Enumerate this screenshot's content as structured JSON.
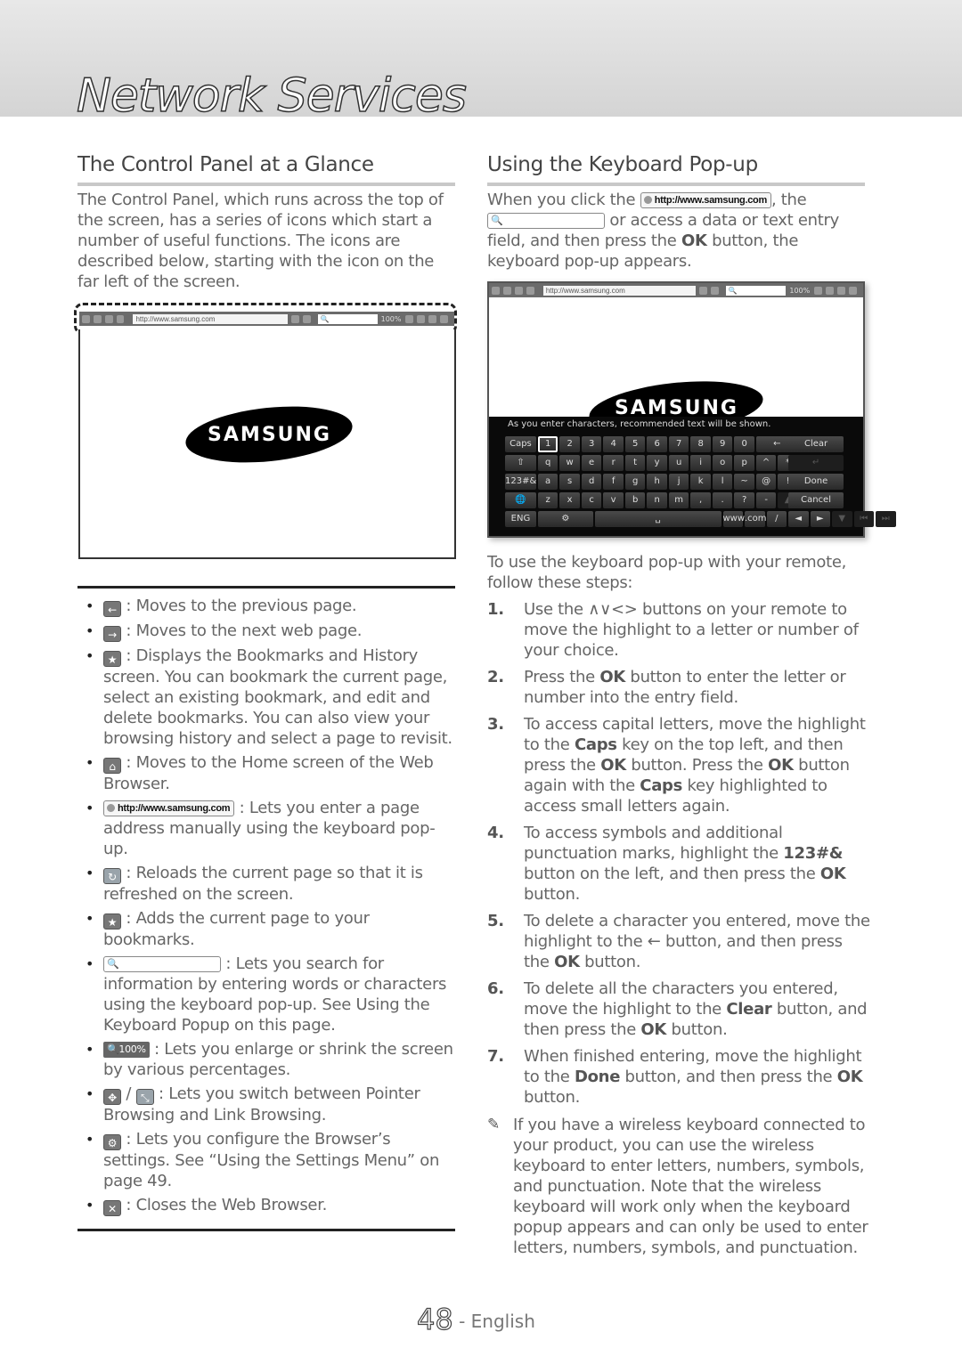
{
  "page": {
    "chapter_title": "Network Services",
    "page_number": "48",
    "language": "- English"
  },
  "left": {
    "title": "The Control Panel at a Glance",
    "intro": "The Control Panel, which runs across the top of the screen, has a series of icons which start a number of useful functions. The icons are described below, starting with the icon on the far left of the screen.",
    "toolbar": {
      "url": "http://www.samsung.com",
      "zoom": "100%",
      "search_icon": "🔍"
    },
    "logo": "SAMSUNG",
    "bullets": [
      {
        "icon": "back-arrow-icon",
        "glyph": "←",
        "text": ": Moves to the previous page."
      },
      {
        "icon": "forward-arrow-icon",
        "glyph": "→",
        "text": ": Moves to the next web page."
      },
      {
        "icon": "bookmarks-icon",
        "glyph": "★",
        "text": ": Displays the Bookmarks and History screen. You can bookmark the current page, select an existing bookmark, and edit and delete bookmarks. You can also view your browsing history and select a page to revisit."
      },
      {
        "icon": "home-icon",
        "glyph": "⌂",
        "text": ": Moves to the Home screen of the Web Browser."
      },
      {
        "icon": "url-field-icon",
        "glyph": "http://www.samsung.com",
        "text": ": Lets you enter a page address manually using the keyboard pop-up."
      },
      {
        "icon": "reload-icon",
        "glyph": "↻",
        "text": ": Reloads the current page so that it is refreshed on the screen."
      },
      {
        "icon": "add-bookmark-icon",
        "glyph": "★",
        "text": ": Adds the current page to your bookmarks."
      },
      {
        "icon": "search-field-icon",
        "glyph": "🔍",
        "text": ": Lets you search for information by entering words or characters using the keyboard pop-up. See Using the Keyboard Popup on this page."
      },
      {
        "icon": "zoom-icon",
        "glyph": "🔍100%",
        "text": ": Lets you enlarge or shrink the screen by various percentages."
      },
      {
        "icon": "pointer-link-browsing-icon",
        "glyph": "✥",
        "glyph2": "⤡",
        "sep": "/",
        "text": ": Lets you switch between Pointer Browsing and Link Browsing."
      },
      {
        "icon": "settings-icon",
        "glyph": "⚙",
        "text": ": Lets you configure the Browser’s settings. See “Using the Settings Menu” on page 49."
      },
      {
        "icon": "close-icon",
        "glyph": "✕",
        "text": ": Closes the Web Browser."
      }
    ]
  },
  "right": {
    "title": "Using the Keyboard Pop-up",
    "intro_a": "When you click the",
    "intro_url": "http://www.samsung.com",
    "intro_b": ", the",
    "intro_c": "or access a data or text entry field, and then press the",
    "intro_ok": "OK",
    "intro_d": "button, the keyboard pop-up appears.",
    "keyboard": {
      "hint": "As you enter characters, recommended text will be shown.",
      "rows": [
        [
          "Caps",
          "1",
          "2",
          "3",
          "4",
          "5",
          "6",
          "7",
          "8",
          "9",
          "0",
          "←",
          "Clear"
        ],
        [
          "⇧",
          "q",
          "w",
          "e",
          "r",
          "t",
          "y",
          "u",
          "i",
          "o",
          "p",
          "^",
          "*",
          "↵"
        ],
        [
          "123#&",
          "a",
          "s",
          "d",
          "f",
          "g",
          "h",
          "j",
          "k",
          "l",
          "~",
          "@",
          "!",
          "Done"
        ],
        [
          "🌐",
          "z",
          "x",
          "c",
          "v",
          "b",
          "n",
          "m",
          ",",
          ".",
          "?",
          "-",
          "▲",
          "Cancel"
        ],
        [
          "ENG",
          "⚙",
          "␣",
          "www.",
          ".com",
          "/",
          "◄",
          "►",
          "▼",
          "⏮",
          "⏭"
        ]
      ]
    },
    "steps_intro": "To use the keyboard pop-up with your remote, follow these steps:",
    "steps": [
      {
        "num": "1.",
        "html": "Use the ∧∨<> buttons on your remote to move the highlight to a letter or number of your choice."
      },
      {
        "num": "2.",
        "html": "Press the <b>OK</b> button to enter the letter or number into the entry field."
      },
      {
        "num": "3.",
        "html": "To access capital letters, move the highlight to the <b>Caps</b> key on the top left, and then press the <b>OK</b> button. Press the <b>OK</b> button again with the <b>Caps</b> key highlighted to access small letters again."
      },
      {
        "num": "4.",
        "html": "To access symbols and additional punctuation marks, highlight the <b>123#&amp;</b> button on the left, and then press the <b>OK</b> button."
      },
      {
        "num": "5.",
        "html": "To delete a character you entered, move the highlight to the ← button, and then press the <b>OK</b> button."
      },
      {
        "num": "6.",
        "html": "To delete all the characters you entered, move the highlight to the <b>Clear</b> button, and then press the <b>OK</b> button."
      },
      {
        "num": "7.",
        "html": "When finished entering, move the highlight to the <b>Done</b> button, and then press the <b>OK</b> button."
      }
    ],
    "note": "If you have a wireless keyboard connected to your product, you can use the wireless keyboard to enter letters, numbers, symbols, and punctuation. Note that the wireless keyboard will work only when the keyboard popup appears and can only be used to enter letters, numbers, symbols, and punctuation.",
    "note_icon": "✎"
  }
}
